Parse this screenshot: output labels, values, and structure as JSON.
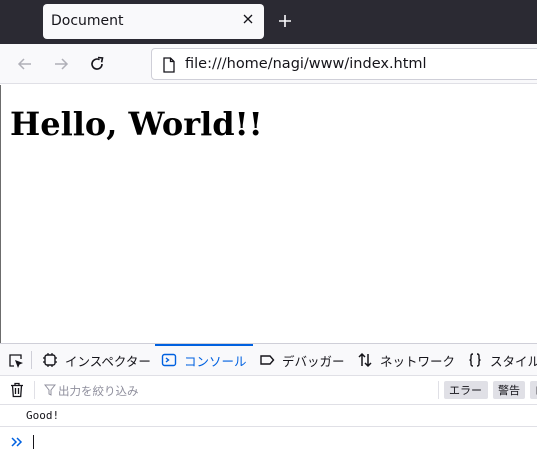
{
  "browser": {
    "tab": {
      "title": "Document"
    },
    "url": "file:///home/nagi/www/index.html"
  },
  "page": {
    "heading": "Hello, World!!"
  },
  "devtools": {
    "tabs": [
      {
        "label": "インスペクター",
        "icon": "inspector-icon",
        "selected": false
      },
      {
        "label": "コンソール",
        "icon": "console-icon",
        "selected": true
      },
      {
        "label": "デバッガー",
        "icon": "debugger-icon",
        "selected": false
      },
      {
        "label": "ネットワーク",
        "icon": "network-icon",
        "selected": false
      },
      {
        "label": "スタイル",
        "icon": "style-editor-icon",
        "selected": false
      }
    ],
    "filter": {
      "placeholder": "出力を絞り込み",
      "value": ""
    },
    "levels": [
      {
        "label": "エラー"
      },
      {
        "label": "警告"
      },
      {
        "label": "ロ"
      }
    ],
    "console": {
      "messages": [
        "Good!"
      ]
    }
  },
  "colors": {
    "tabstrip": "#2b2a33",
    "accent": "#0061e0"
  }
}
